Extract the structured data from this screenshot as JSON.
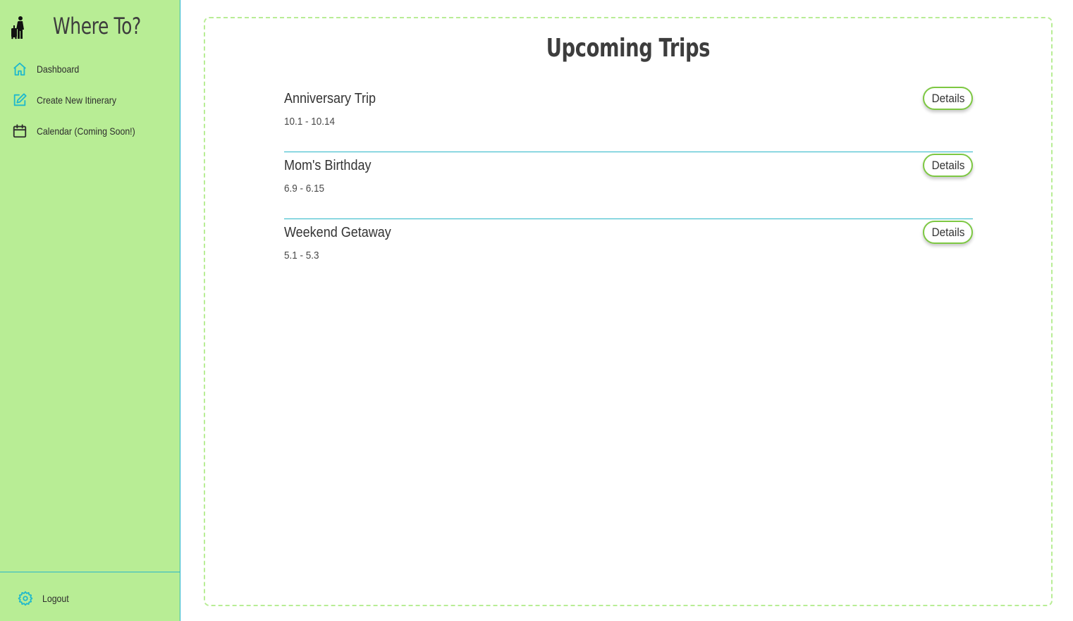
{
  "app": {
    "title": "Where To?"
  },
  "sidebar": {
    "items": [
      {
        "label": "Dashboard",
        "icon": "home-icon"
      },
      {
        "label": "Create New Itinerary",
        "icon": "edit-icon"
      },
      {
        "label": "Calendar (Coming Soon!)",
        "icon": "calendar-icon"
      }
    ],
    "logout_label": "Logout"
  },
  "main": {
    "title": "Upcoming Trips",
    "trips": [
      {
        "name": "Anniversary Trip",
        "dates": "10.1 - 10.14",
        "button": "Details"
      },
      {
        "name": "Mom's Birthday",
        "dates": "6.9 - 6.15",
        "button": "Details"
      },
      {
        "name": "Weekend Getaway",
        "dates": "5.1 - 5.3",
        "button": "Details"
      }
    ]
  },
  "colors": {
    "sidebar_bg": "#b8ed95",
    "accent": "#29b6c8",
    "button_border": "#7dc842"
  }
}
